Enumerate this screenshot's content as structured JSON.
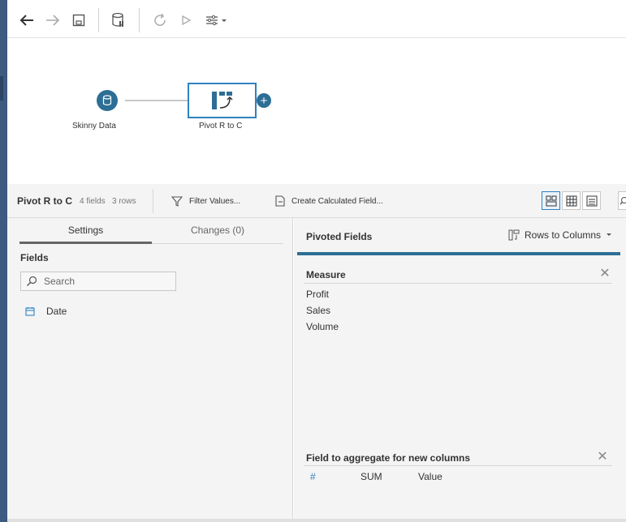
{
  "canvas": {
    "input_node_label": "Skinny Data",
    "pivot_node_label": "Pivot R to C",
    "add_button_symbol": "+"
  },
  "step": {
    "title": "Pivot R to C",
    "fields_count": "4 fields",
    "rows_count": "3 rows",
    "filter_values_label": "Filter Values...",
    "create_calc_label": "Create Calculated Field..."
  },
  "left": {
    "tabs": [
      {
        "label": "Settings",
        "active": true
      },
      {
        "label": "Changes (0)",
        "active": false
      }
    ],
    "fields_title": "Fields",
    "search_placeholder": "Search",
    "fields": [
      {
        "name": "Date",
        "icon": "calendar-icon"
      }
    ]
  },
  "right": {
    "pivoted_fields_title": "Pivoted Fields",
    "pivot_direction": "Rows to Columns",
    "measure_title": "Measure",
    "measure_items": [
      "Profit",
      "Sales",
      "Volume"
    ],
    "aggregate_title": "Field to aggregate for new columns",
    "aggregate": {
      "type_symbol": "#",
      "function": "SUM",
      "field": "Value"
    }
  },
  "colors": {
    "accent": "#2d6e96",
    "selection": "#2f82c0",
    "panel_bg": "#f4f4f4"
  }
}
